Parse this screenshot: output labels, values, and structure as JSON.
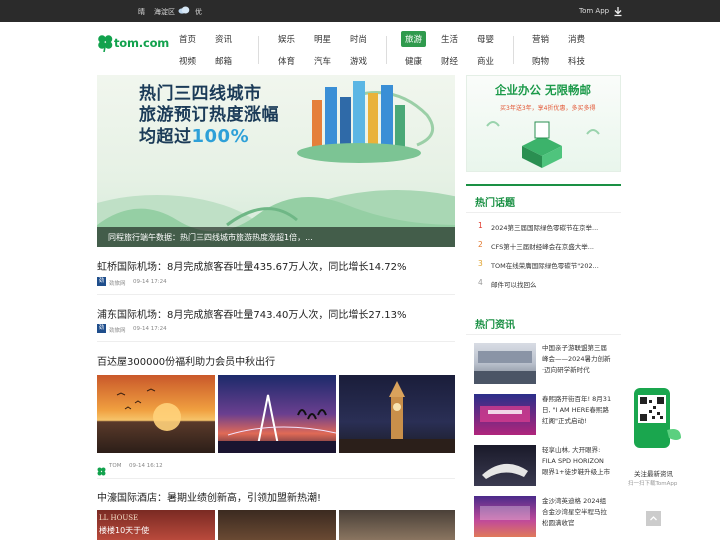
{
  "topbar": {
    "weather": "晴",
    "district": "海淀区",
    "air": "优",
    "app_label": "Tom App"
  },
  "logo": {
    "text": "tom.com"
  },
  "nav": [
    {
      "label": "首页"
    },
    {
      "label": "资讯"
    },
    {
      "label": "视频"
    },
    {
      "label": "邮箱"
    },
    {
      "label": "娱乐"
    },
    {
      "label": "明星"
    },
    {
      "label": "时尚"
    },
    {
      "label": "体育"
    },
    {
      "label": "汽车"
    },
    {
      "label": "游戏"
    },
    {
      "label": "旅游"
    },
    {
      "label": "生活"
    },
    {
      "label": "母婴"
    },
    {
      "label": "健康"
    },
    {
      "label": "财经"
    },
    {
      "label": "商业"
    },
    {
      "label": "营销"
    },
    {
      "label": "消费"
    },
    {
      "label": "购物"
    },
    {
      "label": "科技"
    }
  ],
  "hero": {
    "line1": "热门三四线城市",
    "line2": "旅游预订热度涨幅",
    "line3": "均超过",
    "pct": "100%",
    "caption": "同程旅行端午数据：热门三四线城市旅游热度涨超1倍，..."
  },
  "news": [
    {
      "title": "虹桥国际机场：8月完成旅客吞吐量435.67万人次，同比增长14.72%",
      "source": "劲旅网",
      "time": "09-14 17:24",
      "icon": "劲"
    },
    {
      "title": "浦东国际机场：8月完成旅客吞吐量743.40万人次，同比增长27.13%",
      "source": "劲旅网",
      "time": "09-14 17:24",
      "icon": "劲"
    },
    {
      "title": "百达屋300000份福利助力会员中秋出行",
      "source": "TOM",
      "time": "09-14 16:12"
    },
    {
      "title": "中濠国际酒店：暑期业绩创新高，引领加盟新热潮!"
    }
  ],
  "photo_sign": {
    "line1": "LL HOUSE",
    "line2": "楼楼10天于使"
  },
  "ad": {
    "title": "企业办公 无限畅邮",
    "subtitle": "买3年送3年，享4折优惠，多买多得"
  },
  "hot_topics": {
    "title": "热门话题",
    "items": [
      {
        "num": "1",
        "text": "2024第三届国际绿色零碳节在京举...",
        "color": "#e03b2e"
      },
      {
        "num": "2",
        "text": "CFS第十三届财经峰会在京盛大举...",
        "color": "#e0782e"
      },
      {
        "num": "3",
        "text": "TOM在线荣膺国际绿色零碳节\"202...",
        "color": "#e0a22e"
      },
      {
        "num": "4",
        "text": "邮件可以找回么",
        "color": "#999999"
      }
    ]
  },
  "hot_news": {
    "title": "热门资讯",
    "items": [
      {
        "text": "中国亲子游联盟第三届峰会——2024暑力创新·迈向研学新时代"
      },
      {
        "text": "春熙路开街百年! 8月31日, \"I AM HERE春熙路红阁\"正式启动!"
      },
      {
        "text": "轻享山林, 大开眼界: FILA SPD HORIZON 眼界1+徒步鞋升级上市"
      },
      {
        "text": "金沙湾英迪格 2024组合金沙湾星空半程马拉松圆满收官"
      }
    ]
  },
  "follow": {
    "line1": "关注最新资讯",
    "line2": "扫一扫下载TomApp"
  },
  "colors": {
    "brand": "#12a24d",
    "active_nav": "#2f9a4d",
    "section": "#1a9044",
    "topbar": "#2b2b2b"
  }
}
